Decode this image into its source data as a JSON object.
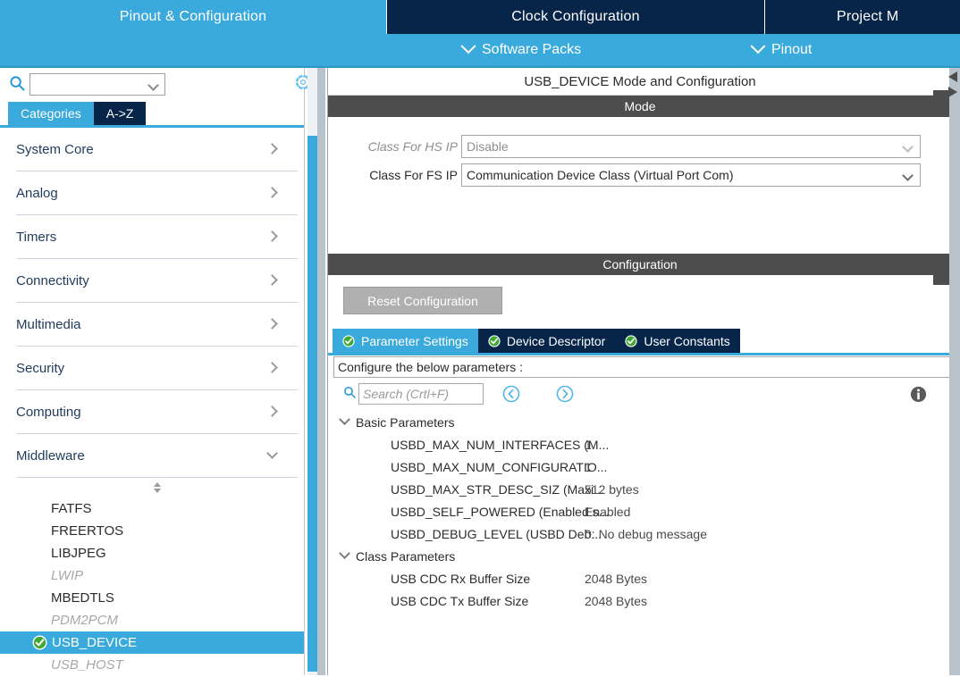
{
  "top_tabs": [
    {
      "label": "Pinout & Configuration",
      "active": true
    },
    {
      "label": "Clock Configuration",
      "active": false
    },
    {
      "label": "Project M",
      "active": false
    }
  ],
  "sub_bar": {
    "software_packs": "Software Packs",
    "pinout": "Pinout",
    "chevron_icon": "chevron-down-icon"
  },
  "left_panel": {
    "search": {
      "value": "",
      "placeholder": ""
    },
    "search_icon": "search-icon",
    "gear_icon": "gear-icon",
    "view_tabs": [
      {
        "label": "Categories",
        "active": true
      },
      {
        "label": "A->Z",
        "active": false
      }
    ],
    "categories": [
      {
        "label": "System Core",
        "expanded": false
      },
      {
        "label": "Analog",
        "expanded": false
      },
      {
        "label": "Timers",
        "expanded": false
      },
      {
        "label": "Connectivity",
        "expanded": false
      },
      {
        "label": "Multimedia",
        "expanded": false
      },
      {
        "label": "Security",
        "expanded": false
      },
      {
        "label": "Computing",
        "expanded": false
      },
      {
        "label": "Middleware",
        "expanded": true
      }
    ],
    "middleware_items": [
      {
        "label": "FATFS",
        "state": "normal"
      },
      {
        "label": "FREERTOS",
        "state": "normal"
      },
      {
        "label": "LIBJPEG",
        "state": "normal"
      },
      {
        "label": "LWIP",
        "state": "disabled"
      },
      {
        "label": "MBEDTLS",
        "state": "normal"
      },
      {
        "label": "PDM2PCM",
        "state": "disabled"
      },
      {
        "label": "USB_DEVICE",
        "state": "selected"
      },
      {
        "label": "USB_HOST",
        "state": "disabled"
      }
    ]
  },
  "main_panel": {
    "title": "USB_DEVICE Mode and Configuration",
    "mode": {
      "band_label": "Mode",
      "fields": [
        {
          "label": "Class For HS IP",
          "value": "Disable",
          "disabled": true
        },
        {
          "label": "Class For FS IP",
          "value": "Communication Device Class (Virtual Port Com)",
          "disabled": false
        }
      ]
    },
    "configuration": {
      "band_label": "Configuration",
      "reset_button": "Reset Configuration",
      "tabs": [
        {
          "label": "Parameter Settings",
          "active": true,
          "icon": "check-circle-icon"
        },
        {
          "label": "Device Descriptor",
          "active": false,
          "icon": "check-circle-icon"
        },
        {
          "label": "User Constants",
          "active": false,
          "icon": "check-circle-icon"
        }
      ],
      "configure_hint": "Configure the below parameters :",
      "toolbar": {
        "search_placeholder": "Search (Crtl+F)",
        "search_value": "",
        "search_icon": "search-icon",
        "prev_icon": "circle-left-arrow-icon",
        "next_icon": "circle-right-arrow-icon",
        "info_icon": "info-icon"
      },
      "param_groups": [
        {
          "name": "Basic Parameters",
          "expanded": true,
          "rows": [
            {
              "key": "USBD_MAX_NUM_INTERFACES (M...",
              "value": "1"
            },
            {
              "key": "USBD_MAX_NUM_CONFIGURATIO...",
              "value": "1"
            },
            {
              "key": "USBD_MAX_STR_DESC_SIZ (Maxi...",
              "value": "512 bytes"
            },
            {
              "key": "USBD_SELF_POWERED (Enabled s...",
              "value": "Enabled"
            },
            {
              "key": "USBD_DEBUG_LEVEL (USBD Deb...",
              "value": "0: No debug message"
            }
          ]
        },
        {
          "name": "Class Parameters",
          "expanded": true,
          "rows": [
            {
              "key": "USB CDC Rx Buffer Size",
              "value": "2048 Bytes"
            },
            {
              "key": "USB CDC Tx Buffer Size",
              "value": "2048 Bytes"
            }
          ]
        }
      ]
    }
  },
  "colors": {
    "accent_light_blue": "#3aa9dc",
    "accent_dark_navy": "#062548",
    "band_gray": "#4d4d4d",
    "check_green": "#4aa83a",
    "splitter_gray": "#b7c2cb"
  }
}
